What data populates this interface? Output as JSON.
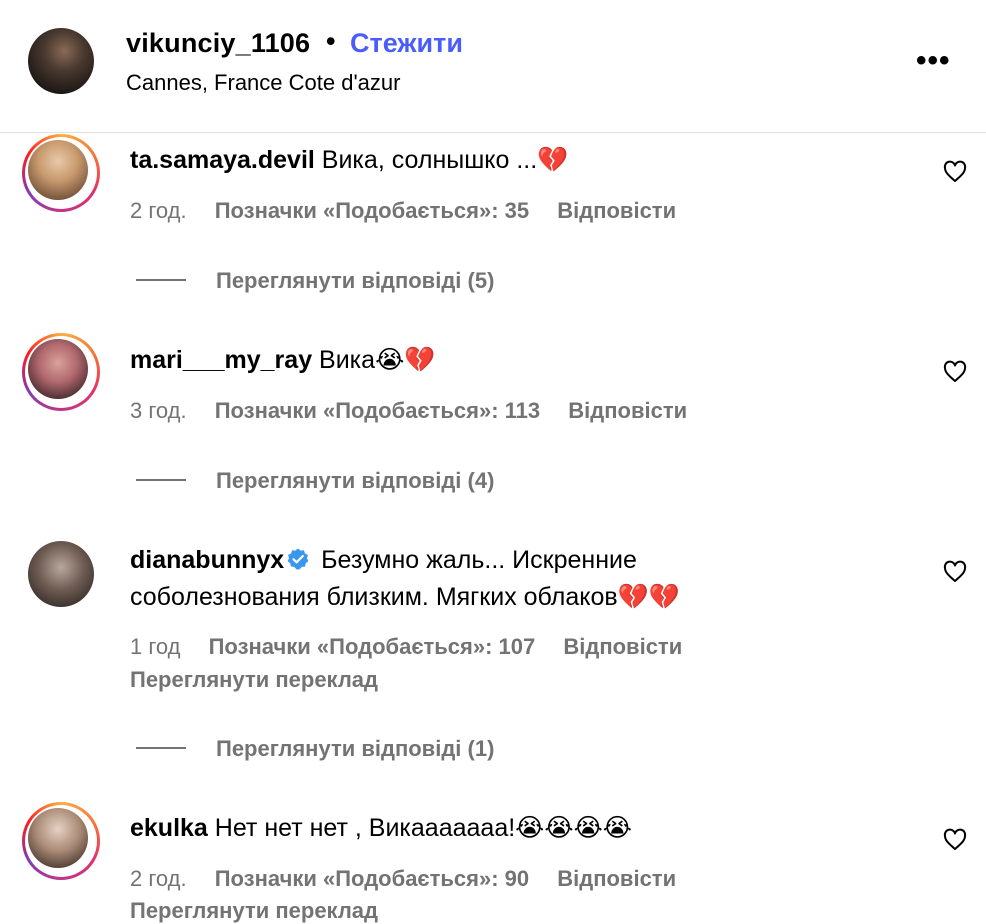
{
  "header": {
    "username": "vikunciy_1106",
    "separator": "•",
    "follow_label": "Стежити",
    "location": "Cannes, France Cote d'azur",
    "more_label": "•••"
  },
  "comments": [
    {
      "username": "ta.samaya.devil",
      "text": "Вика, солнышко ...💔",
      "time": "2 год.",
      "likes": "Позначки «Подобається»: 35",
      "reply": "Відповісти",
      "view_replies": "Переглянути відповіді (5)"
    },
    {
      "username": "mari___my_ray",
      "text": "Вика😭💔",
      "time": "3 год.",
      "likes": "Позначки «Подобається»: 113",
      "reply": "Відповісти",
      "view_replies": "Переглянути відповіді (4)"
    },
    {
      "username": "dianabunnyx",
      "text_line1": "Безумно жаль... Искренние",
      "text_line2": "соболезнования близким. Мягких облаков💔💔",
      "time": "1 год",
      "likes": "Позначки «Подобається»: 107",
      "reply": "Відповісти",
      "translate": "Переглянути переклад",
      "view_replies": "Переглянути відповіді (1)"
    },
    {
      "username": "ekulka",
      "text": "Нет нет нет , Викааааааа!😭😭😭😭",
      "time": "2 год.",
      "likes": "Позначки «Подобається»: 90",
      "reply": "Відповісти",
      "translate": "Переглянути переклад"
    }
  ],
  "colors": {
    "follow": "#4a5df9",
    "meta": "#737373",
    "verified": "#3897f0"
  },
  "icons": [
    "more-icon",
    "heart-icon",
    "verified-icon"
  ]
}
